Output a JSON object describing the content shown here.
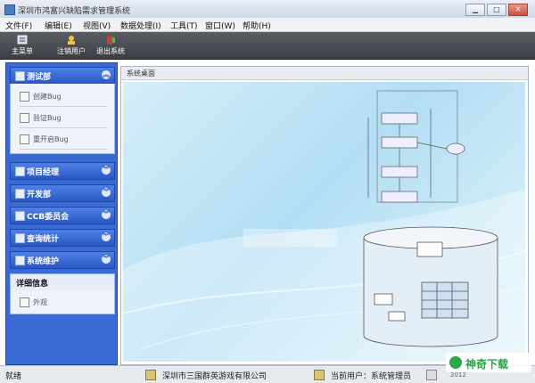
{
  "window": {
    "title": "深圳市鸿富兴缺陷需求管理系统",
    "controls": [
      "▁",
      "□",
      "✕"
    ]
  },
  "menu": [
    "文件(F)",
    "编辑(E)",
    "视图(V)",
    "数据处理(I)",
    "工具(T)",
    "窗口(W)",
    "帮助(H)"
  ],
  "toolbar": {
    "main_menu": "主菜单",
    "logout_user": "注销用户",
    "exit_system": "退出系统"
  },
  "sidebar": {
    "test_dept": {
      "label": "测试部",
      "items": [
        "创建Bug",
        "验证Bug",
        "重开启Bug"
      ]
    },
    "groups": [
      "项目经理",
      "开发部",
      "CCB委员会",
      "查询统计",
      "系统维护"
    ],
    "detail": {
      "label": "详细信息",
      "items": [
        "外观"
      ]
    }
  },
  "content": {
    "title": "系统桌面"
  },
  "status": {
    "left": "就绪",
    "company": "深圳市三国群英游戏有限公司",
    "current_user": "当前用户：系统管理员"
  },
  "watermark": {
    "text": "神奇下载",
    "extra": "2012"
  },
  "colors": {
    "sidebar": "#3a6bd4",
    "group_header": "#2a57c2",
    "toolbar": "#3c3f44",
    "desktop": "#b3def4",
    "watermark_green": "#27a148"
  }
}
